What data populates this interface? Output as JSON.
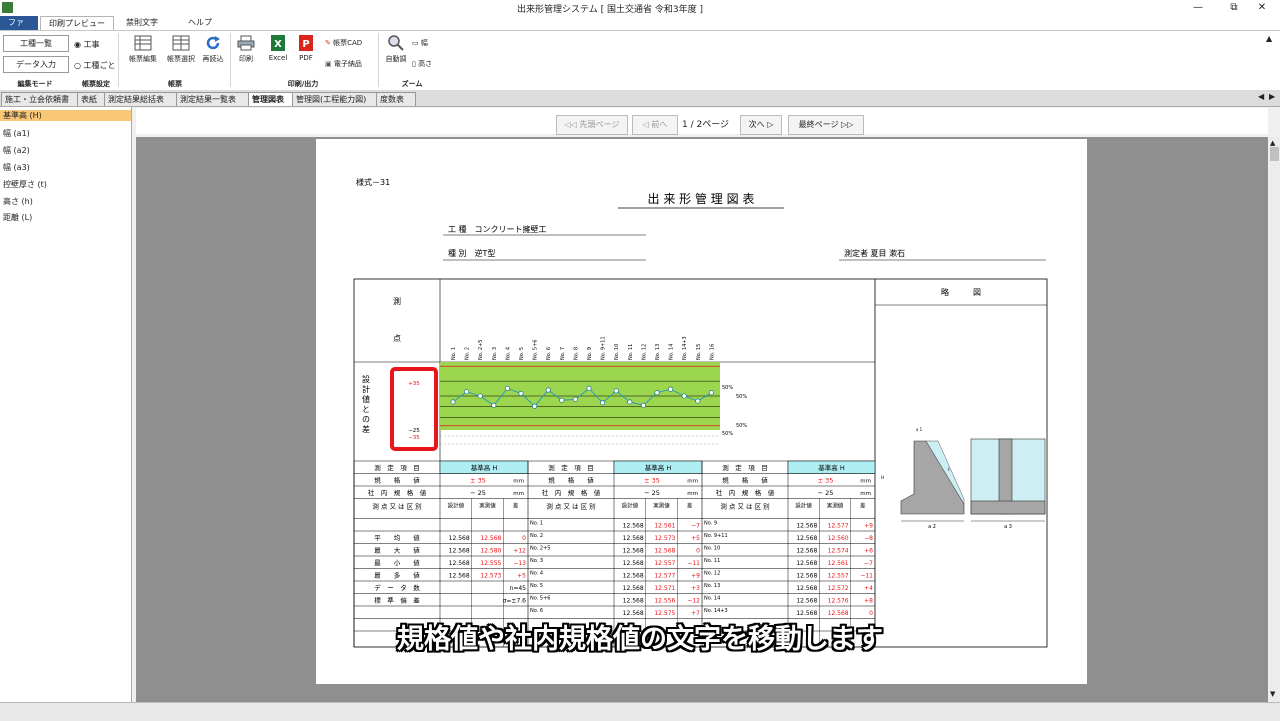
{
  "window": {
    "title": "出来形管理システム [ 国土交通省 令和3年度 ]",
    "minimize": "—",
    "restore": "⧉",
    "close": "✕"
  },
  "menu_tabs": [
    "ファイル",
    "印刷プレビュー",
    "禁則文字",
    "ヘルプ"
  ],
  "ribbon": {
    "edit_mode": {
      "btn1": "工種一覧",
      "btn2": "データ入力",
      "radio1": "工事",
      "radio2": "工種ごと",
      "group": "編集モード"
    },
    "form_settings": {
      "group": "帳票設定"
    },
    "forms": {
      "b1": "帳票編集",
      "b2": "帳票選択",
      "b3": "再読込",
      "group": "帳票"
    },
    "print": {
      "b1": "印刷",
      "b2": "Excel",
      "b3": "PDF",
      "b4": "帳票CAD",
      "b5": "電子納品",
      "group": "印刷/出力"
    },
    "zoom": {
      "b1": "自動調",
      "b2": "幅",
      "b3": "高さ",
      "group": "ズーム"
    }
  },
  "doc_tabs": [
    "施工・立会依頼書",
    "表紙",
    "測定結果総括表",
    "測定結果一覧表",
    "管理図表",
    "管理図(工程能力図)",
    "度数表"
  ],
  "left_items": [
    "基準高 (H)",
    "幅 (a1)",
    "幅 (a2)",
    "幅 (a3)",
    "控壁厚さ (t)",
    "高さ (h)",
    "距離 (L)"
  ],
  "nav": {
    "first": "先頭ページ",
    "prev": "前へ",
    "page": "1 / 2ページ",
    "next": "次へ",
    "last": "最終ページ"
  },
  "doc": {
    "form_no": "様式－31",
    "title": "出 来 形 管 理 図 表",
    "koshu": "工 種　コンクリート擁壁工",
    "shubetsu": "種 別　逆T型",
    "sokuteisha": "測定者 夏目 漱石",
    "ryakuzu": "略　　　図",
    "sokuten_1": "測",
    "sokuten_2": "点",
    "diff_label": "設計値との差",
    "tol_upper": "+35",
    "tol_lower_1": "−25",
    "tol_lower_2": "−35",
    "pct": "50%",
    "points": [
      "No. 1",
      "No. 2",
      "No. 2+5",
      "No. 3",
      "No. 4",
      "No. 5",
      "No. 5+6",
      "No. 6",
      "No. 7",
      "No. 8",
      "No. 9",
      "No. 9+11",
      "No. 10",
      "No. 11",
      "No. 12",
      "No. 13",
      "No. 14",
      "No. 14+3",
      "No. 15",
      "No. 16"
    ],
    "row_labels": {
      "item": "測　定　項　目",
      "kikaku": "規　　格　　値",
      "shanai": "社　内　規　格　値",
      "kubun": "測 点 又 は 区 別"
    },
    "item_value": "基準高 H",
    "kikaku_value": "± 35",
    "shanai_value": "− 25",
    "unit": "mm",
    "sub_headers": [
      "設計値",
      "実測値",
      "差"
    ],
    "stats_labels": [
      "平　　均　　値",
      "最　　大　　値",
      "最　　小　　値",
      "最　　多　　値",
      "デ　ー　タ　数",
      "標　準　偏　差"
    ],
    "stats_rows": [
      [
        "12.568",
        "12.568",
        "0"
      ],
      [
        "12.568",
        "12.580",
        "+12"
      ],
      [
        "12.568",
        "12.555",
        "−13"
      ],
      [
        "12.568",
        "12.573",
        "+5"
      ],
      [
        "",
        "",
        "n=45"
      ],
      [
        "",
        "",
        "σ=±7.6"
      ]
    ],
    "col1_rows": [
      [
        "No. 1",
        "12.568",
        "12.561",
        "−7"
      ],
      [
        "No. 2",
        "12.568",
        "12.573",
        "+5"
      ],
      [
        "No. 2+5",
        "12.568",
        "12.568",
        "0"
      ],
      [
        "No. 3",
        "12.568",
        "12.557",
        "−11"
      ],
      [
        "No. 4",
        "12.568",
        "12.577",
        "+9"
      ],
      [
        "No. 5",
        "12.568",
        "12.571",
        "+3"
      ],
      [
        "No. 5+6",
        "12.568",
        "12.556",
        "−12"
      ],
      [
        "No. 6",
        "12.568",
        "12.575",
        "+7"
      ]
    ],
    "col2_rows": [
      [
        "No. 9",
        "12.568",
        "12.577",
        "+9"
      ],
      [
        "No. 9+11",
        "12.568",
        "12.560",
        "−8"
      ],
      [
        "No. 10",
        "12.568",
        "12.574",
        "+6"
      ],
      [
        "No. 11",
        "12.568",
        "12.561",
        "−7"
      ],
      [
        "No. 12",
        "12.568",
        "12.557",
        "−11"
      ],
      [
        "No. 13",
        "12.568",
        "12.572",
        "+4"
      ],
      [
        "No. 14",
        "12.568",
        "12.576",
        "+8"
      ],
      [
        "No. 14+3",
        "12.568",
        "12.568",
        "0"
      ]
    ],
    "drawing_labels": [
      "a 1",
      "a 2",
      "a 3",
      "H",
      "t"
    ]
  },
  "subtitle": "規格値や社内規格値の文字を移動します",
  "colors": {
    "chart_bg": "#9cd64f",
    "header_cyan": "#aeeef2",
    "red": "#e8151b",
    "left_sel": "#f9c775",
    "file_tab": "#2b5797"
  },
  "chart_data": {
    "type": "line",
    "x": [
      "No. 1",
      "No. 2",
      "No. 2+5",
      "No. 3",
      "No. 4",
      "No. 5",
      "No. 5+6",
      "No. 6",
      "No. 7",
      "No. 8",
      "No. 9",
      "No. 9+11",
      "No. 10",
      "No. 11",
      "No. 12",
      "No. 13",
      "No. 14",
      "No. 14+3",
      "No. 15",
      "No. 16"
    ],
    "series": [
      {
        "values": [
          -7,
          5,
          0,
          -11,
          9,
          3,
          -12,
          7,
          -5,
          -4,
          9,
          -8,
          6,
          -7,
          -11,
          4,
          8,
          0,
          -6,
          4
        ]
      }
    ],
    "ylim": [
      -40,
      40
    ],
    "limits": {
      "upper": 35,
      "lower": -35,
      "inner_lower": -25
    }
  }
}
